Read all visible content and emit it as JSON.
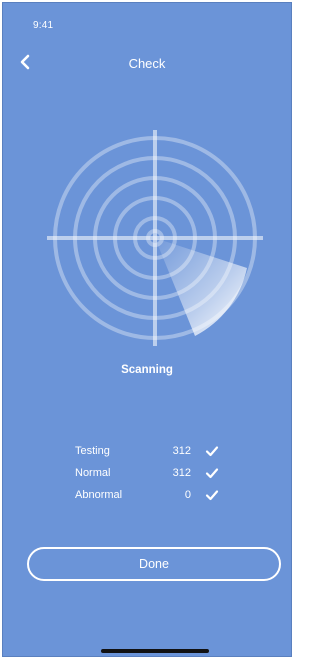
{
  "status_bar": {
    "time": "9:41"
  },
  "header": {
    "title": "Check"
  },
  "scanner": {
    "status": "Scanning"
  },
  "stats": {
    "rows": [
      {
        "label": "Testing",
        "value": "312"
      },
      {
        "label": "Normal",
        "value": "312"
      },
      {
        "label": "Abnormal",
        "value": "0"
      }
    ]
  },
  "actions": {
    "done_label": "Done"
  },
  "colors": {
    "background": "#6b94d8",
    "foreground": "#ffffff"
  }
}
